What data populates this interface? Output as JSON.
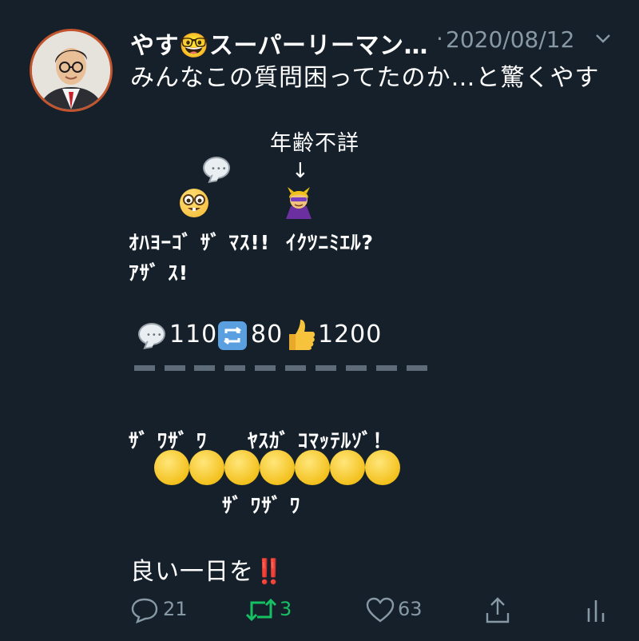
{
  "tweet": {
    "author_name": "やす🤓スーパーリーマン…",
    "separator": "·",
    "date": "2020/08/12",
    "line1": "みんなこの質問困ってたのか…と驚くやす",
    "age_label": "年齢不詳",
    "arrow": "↓",
    "speech_left_1": "ｵﾊﾖｰｺﾞ ｻﾞ ﾏｽ!!",
    "speech_left_2": "ｱｻﾞ ｽ!",
    "speech_right": "ｲｸﾂﾆﾐｴﾙ?",
    "stats": {
      "comment_count": "110",
      "retweet_count": "80",
      "like_count": "1200"
    },
    "crowd_left": "ｻﾞ ﾜｻﾞ ﾜ",
    "crowd_right": "ﾔｽｶﾞ ｺﾏｯﾃﾙｿﾞ！",
    "crowd_bottom": "ｻﾞ ﾜｻﾞ ﾜ",
    "closing": "良い一日を",
    "closing_mark": "‼️",
    "bubble_dots": "•••"
  },
  "actions": {
    "reply_count": "21",
    "retweet_count": "3",
    "like_count": "63"
  },
  "colors": {
    "background": "#15202b",
    "secondary_text": "#8899a6",
    "retweet_green": "#17bf63",
    "closing_mark_red": "#e0245e"
  }
}
